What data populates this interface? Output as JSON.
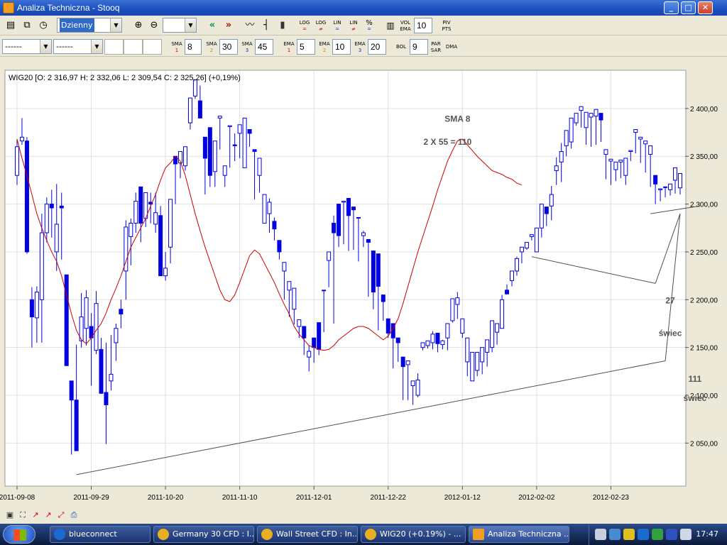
{
  "window": {
    "title": "Analiza Techniczna - Stooq",
    "minimize": "_",
    "maximize": "□",
    "close": "✕"
  },
  "toolbar1": {
    "interval": "Dzienny",
    "buttons": [
      {
        "name": "save-chart-icon",
        "glyph": "▤"
      },
      {
        "name": "copy-chart-icon",
        "glyph": "⧉"
      },
      {
        "name": "refresh-timer-icon",
        "glyph": "◷"
      },
      {
        "name": "zoom-in-icon",
        "glyph": "⊕"
      },
      {
        "name": "zoom-out-icon",
        "glyph": "⊖"
      },
      {
        "name": "scroll-left-icon",
        "glyph": "«"
      },
      {
        "name": "scroll-right-icon",
        "glyph": "»"
      },
      {
        "name": "line-chart-icon",
        "glyph": "〰"
      },
      {
        "name": "ohlc-chart-icon",
        "glyph": "┤"
      },
      {
        "name": "candle-chart-icon",
        "glyph": "▮"
      }
    ],
    "log1": [
      "LOG",
      "="
    ],
    "log2": [
      "LOG",
      "≠"
    ],
    "lin1": [
      "LIN",
      "="
    ],
    "lin2": [
      "LIN",
      "≠"
    ],
    "percent": [
      "%",
      "="
    ],
    "vol_ema": [
      "VOL",
      "EMA"
    ],
    "vol_ema_value": "10",
    "piv_pts": [
      "PIV",
      "PTS"
    ]
  },
  "toolbar2": {
    "combo1": "------",
    "combo2": "------",
    "sma": [
      {
        "label": "SMA",
        "idx": "1",
        "value": "8"
      },
      {
        "label": "SMA",
        "idx": "2",
        "value": "30"
      },
      {
        "label": "SMA",
        "idx": "3",
        "value": "45"
      }
    ],
    "ema": [
      {
        "label": "EMA",
        "idx": "1",
        "value": "5"
      },
      {
        "label": "EMA",
        "idx": "2",
        "value": "10"
      },
      {
        "label": "EMA",
        "idx": "3",
        "value": "20"
      }
    ],
    "bol": {
      "label": "BOL",
      "value": "9"
    },
    "par_sar": [
      "PAR",
      "SAR"
    ],
    "dma": "DMA"
  },
  "chart_header": "WIG20 [O: 2 316,97  H: 2 332,06  L: 2 309,54  C: 2 325,26] (+0,19%)",
  "annotations": [
    {
      "text": "SMA 8",
      "price": 2386,
      "date_index": 89
    },
    {
      "text": "2 X 55 = 110",
      "price": 2362,
      "date_index": 87
    },
    {
      "text": "27",
      "price": 2196,
      "date_index": 132
    },
    {
      "text": "świec",
      "price": 2162,
      "date_index": 132
    },
    {
      "text": "111",
      "price": 2114,
      "date_index": 137
    },
    {
      "text": "świec",
      "price": 2094,
      "date_index": 137
    }
  ],
  "chart_data": {
    "type": "candlestick",
    "title": "WIG20",
    "x_tick_labels": [
      "2011-09-08",
      "2011-09-29",
      "2011-10-20",
      "2011-11-10",
      "2011-12-01",
      "2011-12-22",
      "2012-01-12",
      "2012-02-02",
      "2012-02-23"
    ],
    "y_tick_labels": [
      "2 050,00",
      "2 100,00",
      "2 150,00",
      "2 200,00",
      "2 250,00",
      "2 300,00",
      "2 350,00",
      "2 400,00"
    ],
    "y_ticks": [
      2050,
      2100,
      2150,
      2200,
      2250,
      2300,
      2350,
      2400
    ],
    "ylim": [
      2005,
      2440
    ],
    "grid": true,
    "overlay_series": {
      "name": "SMA 8",
      "color": "#d00000"
    },
    "candle_color": "#0000e0",
    "line_color": "#505050",
    "candles": [
      [
        2330,
        2368,
        2360,
        2320
      ],
      [
        2366,
        2390,
        2370,
        2362
      ],
      [
        2366,
        2370,
        2250,
        2248
      ],
      [
        2200,
        2213,
        2182,
        2150
      ],
      [
        2181,
        2214,
        2208,
        2155
      ],
      [
        2200,
        2290,
        2270,
        2155
      ],
      [
        2270,
        2307,
        2300,
        2260
      ],
      [
        2300,
        2315,
        2296,
        2265
      ],
      [
        2250,
        2321,
        2279,
        2230
      ],
      [
        2298,
        2312,
        2296,
        2242
      ],
      [
        2226,
        2226,
        2131,
        2155
      ],
      [
        2115,
        2115,
        2095,
        2038
      ],
      [
        2095,
        2153,
        2042,
        2043
      ],
      [
        2157,
        2207,
        2182,
        2150
      ],
      [
        2170,
        2210,
        2202,
        2152
      ],
      [
        2172,
        2186,
        2160,
        2110
      ],
      [
        2147,
        2209,
        2196,
        2143
      ],
      [
        2148,
        2160,
        2102,
        2104
      ],
      [
        2103,
        2155,
        2090,
        2049
      ],
      [
        2115,
        2163,
        2122,
        2105
      ],
      [
        2155,
        2175,
        2170,
        2136
      ],
      [
        2190,
        2200,
        2185,
        2170
      ],
      [
        2230,
        2283,
        2276,
        2200
      ],
      [
        2266,
        2285,
        2280,
        2236
      ],
      [
        2280,
        2312,
        2303,
        2270
      ],
      [
        2318,
        2315,
        2280,
        2260
      ],
      [
        2285,
        2310,
        2312,
        2276
      ],
      [
        2302,
        2312,
        2300,
        2280
      ],
      [
        2279,
        2312,
        2291,
        2270
      ],
      [
        2288,
        2298,
        2225,
        2225
      ],
      [
        2225,
        2250,
        2233,
        2220
      ],
      [
        2255,
        2270,
        2305,
        2238
      ],
      [
        2350,
        2350,
        2342,
        2300
      ],
      [
        2343,
        2345,
        2355,
        2327
      ],
      [
        2340,
        2350,
        2360,
        2335
      ],
      [
        2385,
        2393,
        2411,
        2378
      ],
      [
        2413,
        2416,
        2430,
        2410
      ],
      [
        2408,
        2424,
        2390,
        2400
      ],
      [
        2370,
        2360,
        2348,
        2310
      ],
      [
        2380,
        2360,
        2330,
        2318
      ],
      [
        2334,
        2362,
        2366,
        2318
      ],
      [
        2390,
        2357,
        2392,
        2370
      ],
      [
        2330,
        2322,
        2340,
        2318
      ],
      [
        2381,
        2369,
        2382,
        2338
      ],
      [
        2362,
        2374,
        2361,
        2345
      ],
      [
        2374,
        2367,
        2383,
        2348
      ],
      [
        2338,
        2386,
        2390,
        2338
      ],
      [
        2378,
        2364,
        2374,
        2360
      ],
      [
        2357,
        2322,
        2355,
        2305
      ],
      [
        2330,
        2315,
        2348,
        2312
      ],
      [
        2280,
        2305,
        2310,
        2280
      ],
      [
        2290,
        2306,
        2302,
        2270
      ],
      [
        2282,
        2286,
        2274,
        2262
      ],
      [
        2262,
        2242,
        2250,
        2243
      ],
      [
        2230,
        2225,
        2239,
        2200
      ],
      [
        2210,
        2182,
        2219,
        2187
      ],
      [
        2190,
        2174,
        2212,
        2184
      ],
      [
        2172,
        2167,
        2179,
        2160
      ],
      [
        2172,
        2142,
        2160,
        2158
      ],
      [
        2140,
        2152,
        2146,
        2125
      ],
      [
        2160,
        2134,
        2150,
        2142
      ],
      [
        2176,
        2142,
        2148,
        2152
      ],
      [
        2210,
        2193,
        2210,
        2166
      ],
      [
        2241,
        2229,
        2250,
        2213
      ],
      [
        2280,
        2288,
        2270,
        2175
      ],
      [
        2300,
        2263,
        2267,
        2255
      ],
      [
        2302,
        2295,
        2303,
        2258
      ],
      [
        2306,
        2300,
        2288,
        2251
      ],
      [
        2297,
        2268,
        2294,
        2252
      ],
      [
        2286,
        2270,
        2286,
        2240
      ],
      [
        2267,
        2272,
        2270,
        2255
      ],
      [
        2263,
        2220,
        2260,
        2203
      ],
      [
        2251,
        2212,
        2208,
        2190
      ],
      [
        2248,
        2180,
        2214,
        2168
      ],
      [
        2205,
        2180,
        2198,
        2178
      ],
      [
        2180,
        2180,
        2165,
        2160
      ],
      [
        2175,
        2150,
        2160,
        2128
      ],
      [
        2160,
        2135,
        2155,
        2150
      ],
      [
        2140,
        2095,
        2130,
        2135
      ],
      [
        2132,
        2116,
        2136,
        2095
      ],
      [
        2110,
        2103,
        2115,
        2090
      ],
      [
        2100,
        2098,
        2116,
        2123
      ],
      [
        2150,
        2152,
        2155,
        2147
      ],
      [
        2152,
        2151,
        2157,
        2149
      ],
      [
        2155,
        2167,
        2164,
        2148
      ],
      [
        2165,
        2145,
        2154,
        2161
      ],
      [
        2153,
        2148,
        2157,
        2158
      ],
      [
        2160,
        2162,
        2175,
        2147
      ],
      [
        2178,
        2182,
        2201,
        2176
      ],
      [
        2195,
        2208,
        2202,
        2180
      ],
      [
        2165,
        2165,
        2180,
        2160
      ],
      [
        2135,
        2140,
        2160,
        2120
      ],
      [
        2115,
        2125,
        2145,
        2118
      ],
      [
        2126,
        2120,
        2145,
        2128
      ],
      [
        2135,
        2125,
        2150,
        2122
      ],
      [
        2145,
        2140,
        2158,
        2130
      ],
      [
        2150,
        2162,
        2178,
        2145
      ],
      [
        2166,
        2155,
        2175,
        2153
      ],
      [
        2170,
        2205,
        2200,
        2180
      ],
      [
        2210,
        2216,
        2206,
        2210
      ],
      [
        2220,
        2222,
        2230,
        2214
      ],
      [
        2230,
        2245,
        2243,
        2225
      ],
      [
        2250,
        2250,
        2255,
        2238
      ],
      [
        2254,
        2254,
        2260,
        2252
      ],
      [
        2266,
        2267,
        2268,
        2262
      ],
      [
        2250,
        2254,
        2275,
        2265
      ],
      [
        2275,
        2286,
        2300,
        2265
      ],
      [
        2297,
        2293,
        2290,
        2277
      ],
      [
        2298,
        2319,
        2310,
        2283
      ],
      [
        2335,
        2349,
        2340,
        2320
      ],
      [
        2344,
        2364,
        2355,
        2323
      ],
      [
        2361,
        2367,
        2377,
        2350
      ],
      [
        2365,
        2382,
        2390,
        2358
      ],
      [
        2385,
        2387,
        2395,
        2382
      ],
      [
        2398,
        2398,
        2402,
        2380
      ],
      [
        2380,
        2362,
        2396,
        2375
      ],
      [
        2391,
        2378,
        2395,
        2360
      ],
      [
        2392,
        2370,
        2399,
        2362
      ],
      [
        2395,
        2372,
        2388,
        2365
      ],
      [
        2352,
        2330,
        2357,
        2326
      ],
      [
        2345,
        2320,
        2347,
        2325
      ],
      [
        2336,
        2328,
        2344,
        2324
      ],
      [
        2344,
        2334,
        2346,
        2327
      ],
      [
        2330,
        2324,
        2348,
        2320
      ],
      [
        2355,
        2351,
        2356,
        2345
      ],
      [
        2375,
        2357,
        2378,
        2353
      ],
      [
        2368,
        2347,
        2370,
        2343
      ],
      [
        2363,
        2337,
        2366,
        2333
      ],
      [
        2352,
        2318,
        2361,
        2318
      ],
      [
        2330,
        2303,
        2321,
        2300
      ],
      [
        2315,
        2313,
        2316,
        2303
      ],
      [
        2318,
        2307,
        2318,
        2310
      ],
      [
        2315,
        2311,
        2321,
        2309
      ],
      [
        2325,
        2311,
        2338,
        2320
      ],
      [
        2317,
        2325,
        2332,
        2310
      ]
    ],
    "sma8": [
      2368,
      2348,
      2330,
      2310,
      2290,
      2275,
      2262,
      2250,
      2240,
      2225,
      2205,
      2185,
      2168,
      2158,
      2154,
      2160,
      2168,
      2175,
      2186,
      2200,
      2212,
      2225,
      2240,
      2255,
      2265,
      2275,
      2285,
      2298,
      2310,
      2325,
      2338,
      2343,
      2350,
      2345,
      2330,
      2310,
      2290,
      2272,
      2255,
      2240,
      2225,
      2210,
      2200,
      2198,
      2205,
      2218,
      2232,
      2246,
      2252,
      2248,
      2238,
      2228,
      2218,
      2206,
      2195,
      2185,
      2172,
      2164,
      2158,
      2152,
      2150,
      2148,
      2147,
      2148,
      2152,
      2158,
      2162,
      2166,
      2170,
      2172,
      2172,
      2170,
      2166,
      2162,
      2158,
      2162,
      2170,
      2180,
      2196,
      2214,
      2232,
      2250,
      2266,
      2282,
      2298,
      2315,
      2330,
      2345,
      2356,
      2366,
      2368,
      2362,
      2356,
      2350,
      2345,
      2340,
      2335,
      2333,
      2331,
      2328,
      2326,
      2322,
      2320
    ],
    "trend_lines": [
      {
        "from": [
          12,
          2017
        ],
        "to": [
          131,
          2136
        ],
        "label": "111 świec"
      },
      {
        "from": [
          131,
          2136
        ],
        "to": [
          134,
          2290
        ]
      },
      {
        "from": [
          104,
          2245
        ],
        "to": [
          129,
          2217
        ],
        "label": "27 świec"
      },
      {
        "from": [
          129,
          2217
        ],
        "to": [
          134,
          2290
        ]
      },
      {
        "from": [
          128,
          2290
        ],
        "to": [
          138,
          2298
        ]
      }
    ]
  },
  "bottombar": [
    "save-icon",
    "fit-icon",
    "draw-line-icon",
    "draw-arrow-icon",
    "zoom-fit-icon",
    "print-icon"
  ],
  "taskbar": {
    "tasks": [
      {
        "label": "blueconnect",
        "color": "#1a6ad0"
      },
      {
        "label": "Germany 30 CFD : I...",
        "color": "#e8b020"
      },
      {
        "label": "Wall Street CFD : In...",
        "color": "#e8b020"
      },
      {
        "label": "WIG20 (+0.19%) - ...",
        "color": "#e8b020"
      },
      {
        "label": "Analiza Techniczna ...",
        "color": "#f0a020"
      }
    ],
    "clock": "17:47"
  }
}
